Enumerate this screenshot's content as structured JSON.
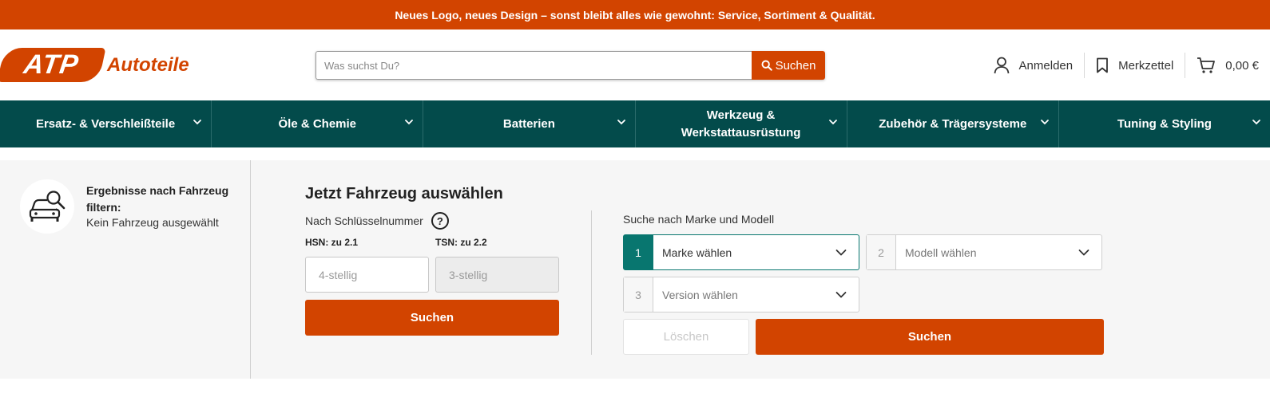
{
  "banner": {
    "text": "Neues Logo, neues Design – sonst bleibt alles wie gewohnt: Service, Sortiment & Qualität."
  },
  "logo": {
    "badge": "ATP",
    "text": "Autoteile"
  },
  "search": {
    "placeholder": "Was suchst Du?",
    "button_label": "Suchen"
  },
  "header_actions": {
    "login": "Anmelden",
    "wishlist": "Merkzettel",
    "cart_total": "0,00 €"
  },
  "nav": {
    "items": [
      {
        "label": "Ersatz- & Verschleißteile"
      },
      {
        "label": "Öle & Chemie"
      },
      {
        "label": "Batterien"
      },
      {
        "label": "Werkzeug & Werkstattausrüstung"
      },
      {
        "label": "Zubehör & Trägersysteme"
      },
      {
        "label": "Tuning & Styling"
      }
    ]
  },
  "filter": {
    "title": "Ergebnisse nach Fahrzeug filtern:",
    "subtitle": "Kein Fahrzeug ausgewählt"
  },
  "vehicle": {
    "title": "Jetzt Fahrzeug auswählen",
    "key_label": "Nach Schlüsselnummer",
    "help": "?",
    "hsn_label": "HSN: zu 2.1",
    "tsn_label": "TSN: zu 2.2",
    "hsn_placeholder": "4-stellig",
    "tsn_placeholder": "3-stellig",
    "key_search": "Suchen",
    "mm_label": "Suche nach Marke und Modell",
    "brand": {
      "num": "1",
      "label": "Marke wählen"
    },
    "model": {
      "num": "2",
      "label": "Modell wählen"
    },
    "version": {
      "num": "3",
      "label": "Version wählen"
    },
    "clear": "Löschen",
    "mm_search": "Suchen"
  },
  "colors": {
    "brand_orange": "#d24400",
    "nav_teal": "#034b4b",
    "active_teal": "#08766f"
  }
}
